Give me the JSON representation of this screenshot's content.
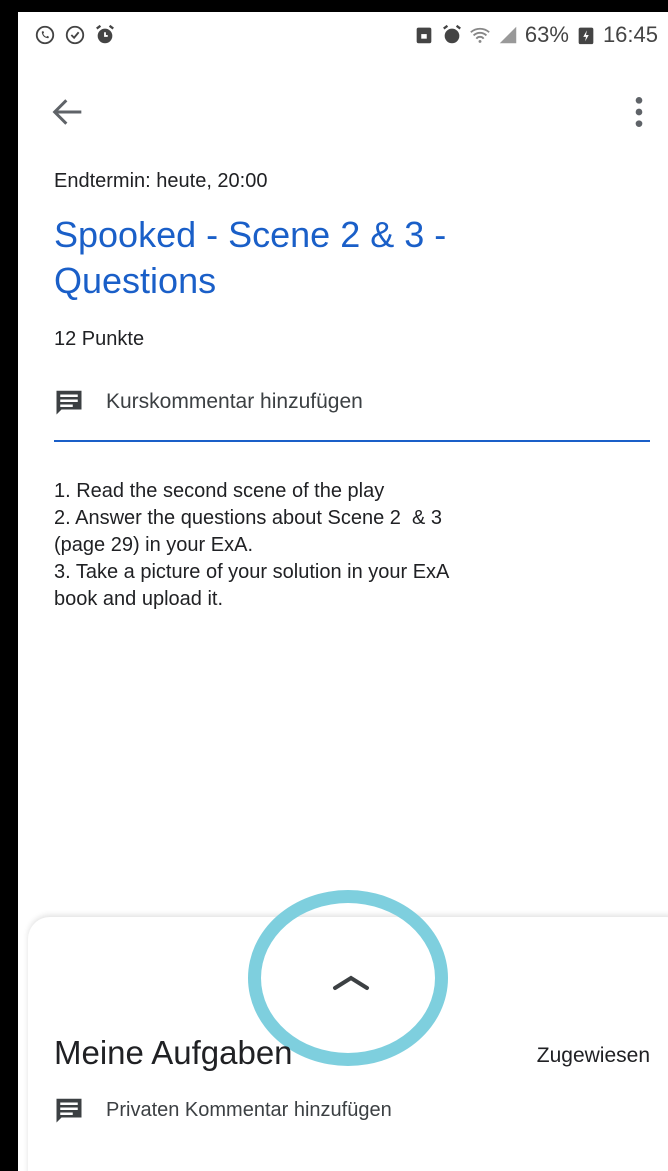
{
  "status_bar": {
    "battery": "63%",
    "time": "16:45"
  },
  "assignment": {
    "due": "Endtermin: heute, 20:00",
    "title_line1": "Spooked - Scene 2 & 3 -",
    "title_line2": "Questions",
    "points": "12 Punkte",
    "class_comment_label": "Kurskommentar hinzufügen",
    "description": [
      "1. Read the second scene of the play",
      "2. Answer the questions about Scene 2  & 3",
      "(page 29) in your ExA.",
      "3. Take a picture of your solution in your ExA",
      "book and upload it."
    ]
  },
  "my_work": {
    "title": "Meine Aufgaben",
    "status": "Zugewiesen",
    "private_comment_label": "Privaten Kommentar hinzufügen"
  },
  "colors": {
    "accent": "#1a5fc8",
    "highlight": "#7ecfde",
    "text": "#202124"
  },
  "icons": {
    "back": "arrow-back-icon",
    "more": "more-vert-icon",
    "comment": "comment-icon",
    "handle": "chevron-up-icon"
  }
}
